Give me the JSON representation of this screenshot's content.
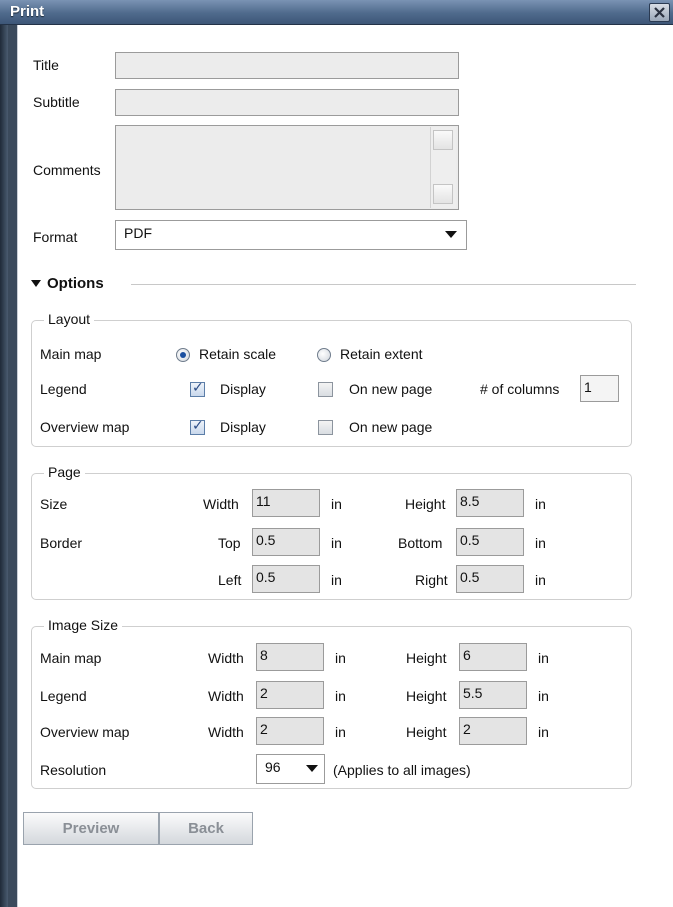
{
  "window": {
    "title": "Print"
  },
  "form": {
    "title_label": "Title",
    "title_value": "",
    "subtitle_label": "Subtitle",
    "subtitle_value": "",
    "comments_label": "Comments",
    "comments_value": "",
    "format_label": "Format",
    "format_value": "PDF"
  },
  "options": {
    "label": "Options",
    "expanded": true
  },
  "layout": {
    "legend": "Layout",
    "main_map_label": "Main map",
    "retain_scale": "Retain scale",
    "retain_extent": "Retain extent",
    "main_map_choice": "Retain scale",
    "legend_label": "Legend",
    "legend_display": "Display",
    "legend_display_checked": true,
    "legend_new_page": "On new page",
    "legend_new_page_checked": false,
    "columns_label": "# of columns",
    "columns_value": "1",
    "overview_label": "Overview map",
    "overview_display": "Display",
    "overview_display_checked": true,
    "overview_new_page": "On new page",
    "overview_new_page_checked": false
  },
  "page": {
    "legend": "Page",
    "size_label": "Size",
    "width_label": "Width",
    "width_value": "11",
    "height_label": "Height",
    "height_value": "8.5",
    "border_label": "Border",
    "top_label": "Top",
    "top_value": "0.5",
    "bottom_label": "Bottom",
    "bottom_value": "0.5",
    "left_label": "Left",
    "left_value": "0.5",
    "right_label": "Right",
    "right_value": "0.5",
    "unit": "in"
  },
  "image_size": {
    "legend": "Image Size",
    "width_label": "Width",
    "height_label": "Height",
    "unit": "in",
    "rows": [
      {
        "label": "Main map",
        "width": "8",
        "height": "6"
      },
      {
        "label": "Legend",
        "width": "2",
        "height": "5.5"
      },
      {
        "label": "Overview map",
        "width": "2",
        "height": "2"
      }
    ],
    "resolution_label": "Resolution",
    "resolution_value": "96",
    "resolution_note": "(Applies to all images)"
  },
  "buttons": {
    "preview": "Preview",
    "back": "Back"
  },
  "colors": {
    "titlebar": "#4f6a8c",
    "radio_dot": "#1a4fa0",
    "check": "#2b4c86"
  }
}
